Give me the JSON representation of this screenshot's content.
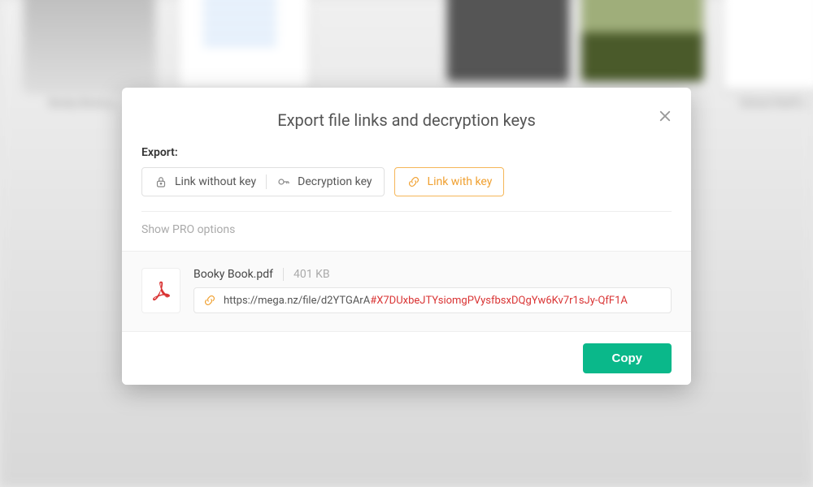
{
  "modal": {
    "title": "Export file links and decryption keys",
    "export_label": "Export:",
    "options": {
      "link_without_key": "Link without key",
      "decryption_key": "Decryption key",
      "link_with_key": "Link with key"
    },
    "pro_options": "Show PRO options",
    "file": {
      "name": "Booky Book.pdf",
      "size": "401 KB",
      "link_base": "https://mega.nz/file/d2YTGArA",
      "link_key": "#X7DUxbeJTYsiomgPVysfbsxDQgYw6Kv7r1sJy-QfF1A"
    },
    "copy_label": "Copy"
  },
  "colors": {
    "accent_orange": "#f0a030",
    "accent_teal": "#0ab88a",
    "key_red": "#d93333"
  }
}
